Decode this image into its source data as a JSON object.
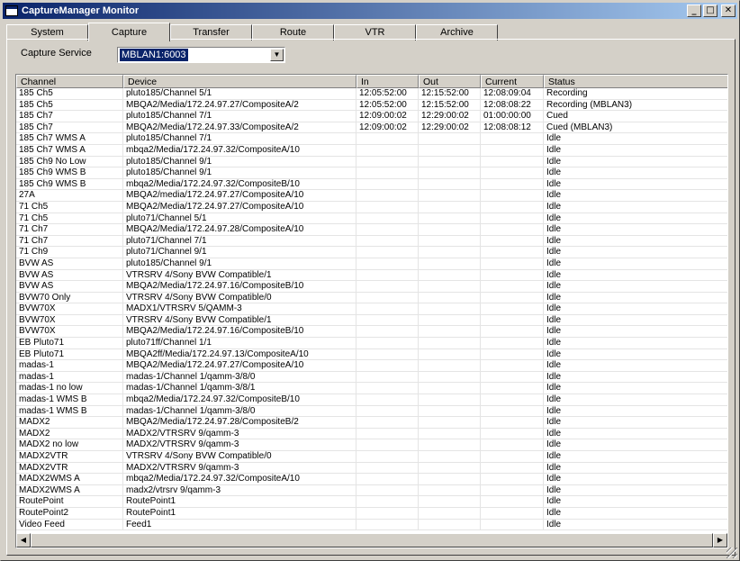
{
  "window": {
    "title": "CaptureManager Monitor",
    "controls": {
      "minimize": "_",
      "maximize": "□",
      "close": "✕"
    }
  },
  "tabs": [
    {
      "label": "System",
      "active": false
    },
    {
      "label": "Capture",
      "active": true
    },
    {
      "label": "Transfer",
      "active": false
    },
    {
      "label": "Route",
      "active": false
    },
    {
      "label": "VTR",
      "active": false
    },
    {
      "label": "Archive",
      "active": false
    }
  ],
  "capture_service": {
    "label": "Capture Service",
    "selected": "MBLAN1:6003",
    "dropdown_arrow": "▼"
  },
  "table": {
    "columns": [
      "Channel",
      "Device",
      "In",
      "Out",
      "Current",
      "Status"
    ],
    "rows": [
      [
        "185 Ch5",
        "pluto185/Channel 5/1",
        "12:05:52:00",
        "12:15:52:00",
        "12:08:09:04",
        "Recording"
      ],
      [
        "185 Ch5",
        "MBQA2/Media/172.24.97.27/CompositeA/2",
        "12:05:52:00",
        "12:15:52:00",
        "12:08:08:22",
        "Recording (MBLAN3)"
      ],
      [
        "185 Ch7",
        "pluto185/Channel 7/1",
        "12:09:00:02",
        "12:29:00:02",
        "01:00:00:00",
        "Cued"
      ],
      [
        "185 Ch7",
        "MBQA2/Media/172.24.97.33/CompositeA/2",
        "12:09:00:02",
        "12:29:00:02",
        "12:08:08:12",
        "Cued (MBLAN3)"
      ],
      [
        "185 Ch7 WMS A",
        "pluto185/Channel 7/1",
        "",
        "",
        "",
        "Idle"
      ],
      [
        "185 Ch7 WMS A",
        "mbqa2/Media/172.24.97.32/CompositeA/10",
        "",
        "",
        "",
        "Idle"
      ],
      [
        "185 Ch9 No Low",
        "pluto185/Channel 9/1",
        "",
        "",
        "",
        "Idle"
      ],
      [
        "185 Ch9 WMS B",
        "pluto185/Channel 9/1",
        "",
        "",
        "",
        "Idle"
      ],
      [
        "185 Ch9 WMS B",
        "mbqa2/Media/172.24.97.32/CompositeB/10",
        "",
        "",
        "",
        "Idle"
      ],
      [
        "27A",
        "MBQA2/media/172.24.97.27/CompositeA/10",
        "",
        "",
        "",
        "Idle"
      ],
      [
        "71 Ch5",
        "MBQA2/Media/172.24.97.27/CompositeA/10",
        "",
        "",
        "",
        "Idle"
      ],
      [
        "71 Ch5",
        "pluto71/Channel 5/1",
        "",
        "",
        "",
        "Idle"
      ],
      [
        "71 Ch7",
        "MBQA2/Media/172.24.97.28/CompositeA/10",
        "",
        "",
        "",
        "Idle"
      ],
      [
        "71 Ch7",
        "pluto71/Channel 7/1",
        "",
        "",
        "",
        "Idle"
      ],
      [
        "71 Ch9",
        "pluto71/Channel 9/1",
        "",
        "",
        "",
        "Idle"
      ],
      [
        "BVW AS",
        "pluto185/Channel 9/1",
        "",
        "",
        "",
        "Idle"
      ],
      [
        "BVW AS",
        "VTRSRV 4/Sony BVW Compatible/1",
        "",
        "",
        "",
        "Idle"
      ],
      [
        "BVW AS",
        "MBQA2/Media/172.24.97.16/CompositeB/10",
        "",
        "",
        "",
        "Idle"
      ],
      [
        "BVW70 Only",
        "VTRSRV 4/Sony BVW Compatible/0",
        "",
        "",
        "",
        "Idle"
      ],
      [
        "BVW70X",
        "MADX1/VTRSRV 5/QAMM-3",
        "",
        "",
        "",
        "Idle"
      ],
      [
        "BVW70X",
        "VTRSRV 4/Sony BVW Compatible/1",
        "",
        "",
        "",
        "Idle"
      ],
      [
        "BVW70X",
        "MBQA2/Media/172.24.97.16/CompositeB/10",
        "",
        "",
        "",
        "Idle"
      ],
      [
        "EB Pluto71",
        "pluto71ff/Channel 1/1",
        "",
        "",
        "",
        "Idle"
      ],
      [
        "EB Pluto71",
        "MBQA2ff/Media/172.24.97.13/CompositeA/10",
        "",
        "",
        "",
        "Idle"
      ],
      [
        "madas-1",
        "MBQA2/Media/172.24.97.27/CompositeA/10",
        "",
        "",
        "",
        "Idle"
      ],
      [
        "madas-1",
        "madas-1/Channel 1/qamm-3/8/0",
        "",
        "",
        "",
        "Idle"
      ],
      [
        "madas-1 no low",
        "madas-1/Channel 1/qamm-3/8/1",
        "",
        "",
        "",
        "Idle"
      ],
      [
        "madas-1 WMS B",
        "mbqa2/Media/172.24.97.32/CompositeB/10",
        "",
        "",
        "",
        "Idle"
      ],
      [
        "madas-1 WMS B",
        "madas-1/Channel 1/qamm-3/8/0",
        "",
        "",
        "",
        "Idle"
      ],
      [
        "MADX2",
        "MBQA2/Media/172.24.97.28/CompositeB/2",
        "",
        "",
        "",
        "Idle"
      ],
      [
        "MADX2",
        "MADX2/VTRSRV 9/qamm-3",
        "",
        "",
        "",
        "Idle"
      ],
      [
        "MADX2 no low",
        "MADX2/VTRSRV 9/qamm-3",
        "",
        "",
        "",
        "Idle"
      ],
      [
        "MADX2VTR",
        "VTRSRV 4/Sony BVW Compatible/0",
        "",
        "",
        "",
        "Idle"
      ],
      [
        "MADX2VTR",
        "MADX2/VTRSRV 9/qamm-3",
        "",
        "",
        "",
        "Idle"
      ],
      [
        "MADX2WMS A",
        "mbqa2/Media/172.24.97.32/CompositeA/10",
        "",
        "",
        "",
        "Idle"
      ],
      [
        "MADX2WMS A",
        "madx2/vtrsrv 9/qamm-3",
        "",
        "",
        "",
        "Idle"
      ],
      [
        "RoutePoint",
        "RoutePoint1",
        "",
        "",
        "",
        "Idle"
      ],
      [
        "RoutePoint2",
        "RoutePoint1",
        "",
        "",
        "",
        "Idle"
      ],
      [
        "Video Feed",
        "Feed1",
        "",
        "",
        "",
        "Idle"
      ]
    ]
  },
  "scrollbar": {
    "left_arrow": "◀",
    "right_arrow": "▶"
  }
}
